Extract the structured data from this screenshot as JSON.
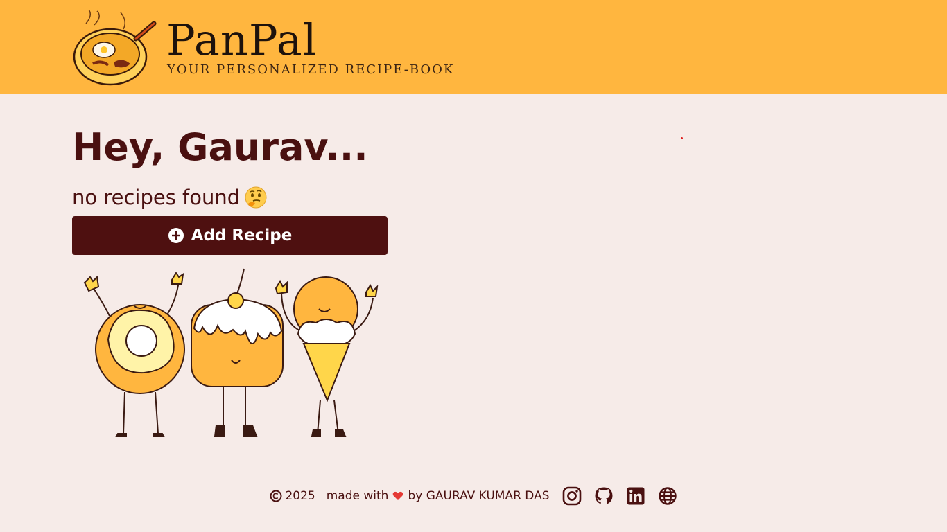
{
  "header": {
    "brand_title": "PanPal",
    "brand_subtitle": "YOUR PERSONALIZED RECIPE-BOOK",
    "logo_icon": "frying-pan-breakfast-logo"
  },
  "main": {
    "greeting": "Hey, Gaurav...",
    "empty_message": "no recipes found",
    "empty_emoji_icon": "thinking-face-emoji",
    "add_recipe_label": "Add Recipe",
    "illustration": "donut-cake-icecream-characters"
  },
  "footer": {
    "year": "2025",
    "made_with": "made with",
    "by_text": "by GAURAV KUMAR DAS",
    "social_icons": [
      "instagram-icon",
      "github-icon",
      "linkedin-icon",
      "globe-icon"
    ]
  },
  "colors": {
    "header_bg": "#ffb63f",
    "page_bg": "#f6ebe8",
    "primary": "#4e1010",
    "heart": "#e53935"
  }
}
